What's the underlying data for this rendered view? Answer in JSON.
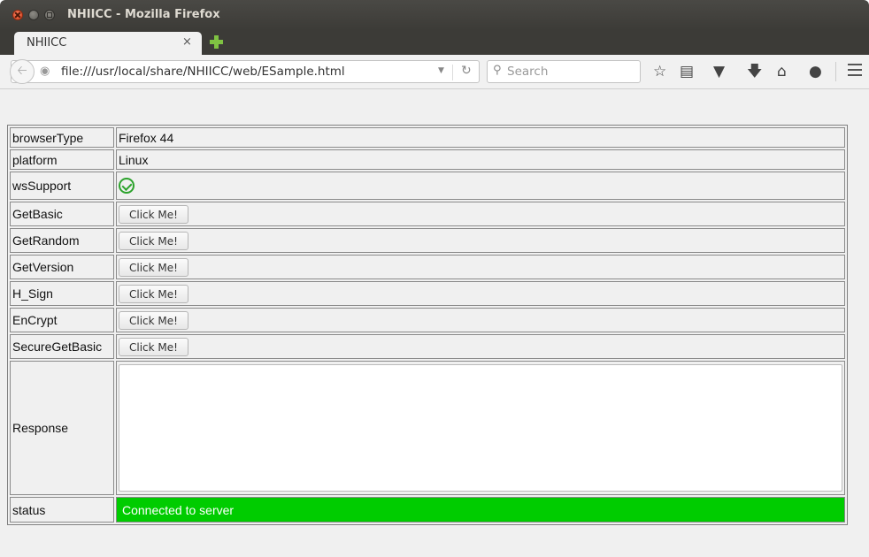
{
  "window": {
    "title": "NHIICC - Mozilla Firefox"
  },
  "tab": {
    "label": "NHIICC",
    "close_glyph": "×"
  },
  "nav": {
    "url": "file:///usr/local/share/NHIICC/web/ESample.html",
    "search_placeholder": "Search"
  },
  "icons": {
    "back": "back-arrow-icon",
    "site": "globe-icon",
    "reload": "reload-icon",
    "search": "search-icon",
    "bookmark": "star-icon",
    "reading_list": "clipboard-icon",
    "pocket": "pocket-icon",
    "downloads": "download-arrow-icon",
    "home": "home-icon",
    "chat": "chat-bubble-icon",
    "menu": "hamburger-menu-icon"
  },
  "rows": {
    "browser_type": {
      "label": "browserType",
      "value": "Firefox 44"
    },
    "platform": {
      "label": "platform",
      "value": "Linux"
    },
    "ws_support": {
      "label": "wsSupport"
    },
    "get_basic": {
      "label": "GetBasic",
      "button": "Click Me!"
    },
    "get_random": {
      "label": "GetRandom",
      "button": "Click Me!"
    },
    "get_version": {
      "label": "GetVersion",
      "button": "Click Me!"
    },
    "h_sign": {
      "label": "H_Sign",
      "button": "Click Me!"
    },
    "encrypt": {
      "label": "EnCrypt",
      "button": "Click Me!"
    },
    "secure_get_basic": {
      "label": "SecureGetBasic",
      "button": "Click Me!"
    },
    "response": {
      "label": "Response",
      "value": ""
    },
    "status": {
      "label": "status",
      "value": "Connected to server"
    }
  },
  "colors": {
    "status_ok": "#00cc00",
    "check_green": "#2da32d",
    "titlebar": "#3c3b37",
    "close_button": "#e5562c"
  }
}
